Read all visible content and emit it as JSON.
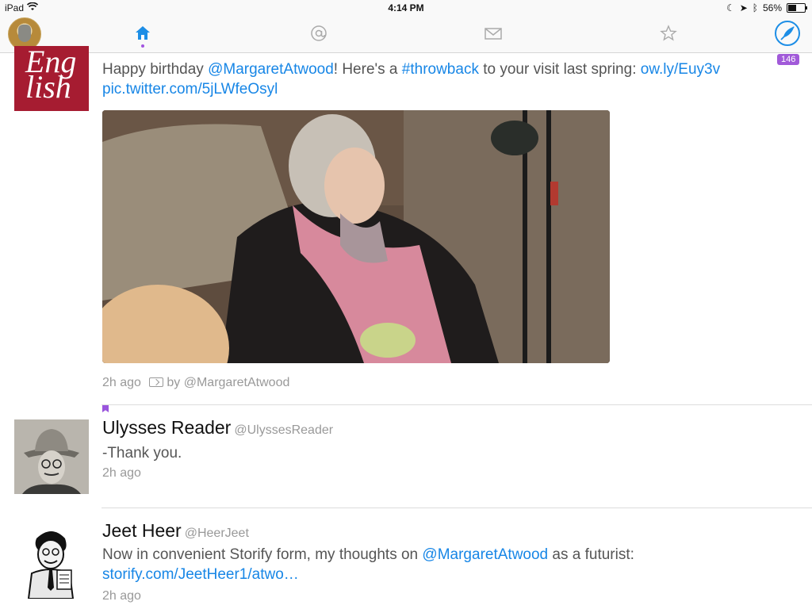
{
  "status_bar": {
    "device": "iPad",
    "time": "4:14 PM",
    "battery": "56%",
    "battery_level": 0.56
  },
  "tabs": [
    {
      "name": "home",
      "icon": "home-icon",
      "active": true
    },
    {
      "name": "mentions",
      "icon": "at-icon"
    },
    {
      "name": "messages",
      "icon": "envelope-icon"
    },
    {
      "name": "favorites",
      "icon": "star-icon"
    }
  ],
  "compose_icon": "compose-feather-icon",
  "unread_count": "146",
  "colors": {
    "accent": "#1786e6",
    "badge": "#a15ad9",
    "english_bg": "#a61c31"
  },
  "tweets": [
    {
      "avatar_text_1": "Eng",
      "avatar_text_2": "lish",
      "text_before": "Happy birthday ",
      "mention": "@MargaretAtwood",
      "text_mid": "! Here's a ",
      "hashtag": "#throwback",
      "text_after": " to your visit last spring: ",
      "url": "ow.ly/Euy3v",
      "pic_url": "pic.twitter.com/5jLWfeOsyl",
      "time": "2h ago",
      "retweet_by": "by @MargaretAtwood"
    },
    {
      "name": "Ulysses Reader",
      "handle": "@UlyssesReader",
      "text": "-Thank you.",
      "time": "2h ago"
    },
    {
      "name": "Jeet Heer",
      "handle": "@HeerJeet",
      "text_before": "Now in convenient Storify form, my thoughts on ",
      "mention": "@MargaretAtwood",
      "text_mid": " as a futurist: ",
      "url": "storify.com/JeetHeer1/atwo…",
      "time": "2h ago"
    }
  ]
}
